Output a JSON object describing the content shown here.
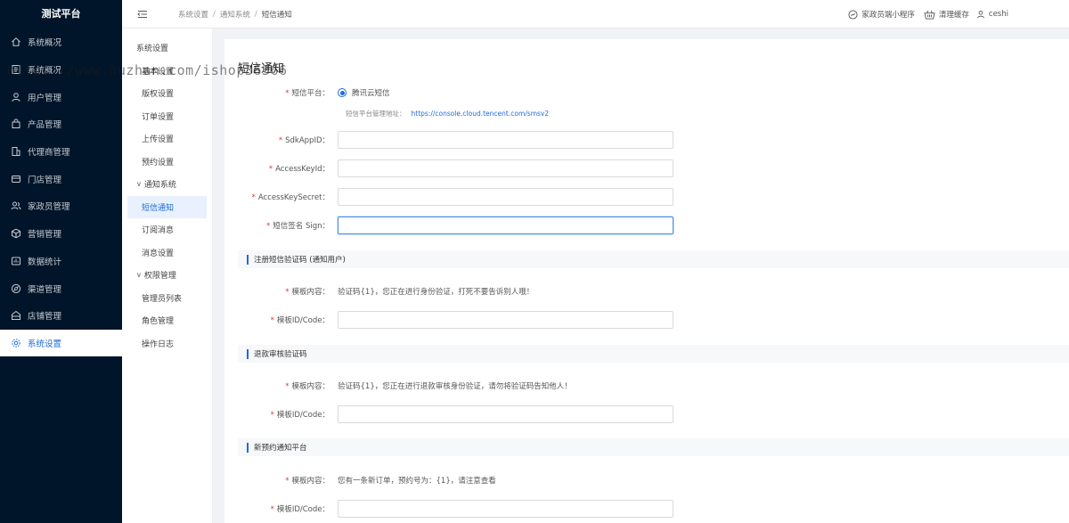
{
  "app": {
    "title": "测试平台"
  },
  "sidebar": {
    "items": [
      {
        "label": "系统概况",
        "icon": "home-icon"
      },
      {
        "label": "系统概况",
        "icon": "document-icon"
      },
      {
        "label": "用户管理",
        "icon": "user-icon"
      },
      {
        "label": "产品管理",
        "icon": "bag-icon"
      },
      {
        "label": "代理商管理",
        "icon": "building-icon"
      },
      {
        "label": "门店管理",
        "icon": "store-icon"
      },
      {
        "label": "家政员管理",
        "icon": "team-icon"
      },
      {
        "label": "营销管理",
        "icon": "cube-icon"
      },
      {
        "label": "数据统计",
        "icon": "stats-icon"
      },
      {
        "label": "渠道管理",
        "icon": "compass-icon"
      },
      {
        "label": "店铺管理",
        "icon": "shop-icon"
      },
      {
        "label": "系统设置",
        "icon": "gear-icon"
      }
    ]
  },
  "header": {
    "breadcrumb": [
      "系统设置",
      "通知系统",
      "短信通知"
    ],
    "miniprogram": "家政员端小程序",
    "clear_cache": "清理缓存",
    "user": "ceshi"
  },
  "submenu": {
    "title": "系统设置",
    "items": [
      "基本设置",
      "版权设置",
      "订单设置",
      "上传设置",
      "预约设置"
    ],
    "group_notify": "通知系统",
    "notify_items": [
      "短信通知",
      "订阅消息",
      "消息设置"
    ],
    "group_perm": "权限管理",
    "perm_items": [
      "管理员列表",
      "角色管理",
      "操作日志"
    ]
  },
  "main": {
    "title": "短信通知",
    "platform_label": "短信平台：",
    "platform_value": "腾讯云短信",
    "platform_hint": "短信平台管理地址：",
    "platform_link": "https://console.cloud.tencent.com/smsv2",
    "sdk_label": "SdkAppID：",
    "key_label": "AccessKeyId：",
    "secret_label": "AccessKeySecret：",
    "sign_label": "短信签名 Sign：",
    "sections": [
      {
        "title": "注册短信验证码 (通知用户)",
        "content_label": "模板内容：",
        "content": "验证码{1}，您正在进行身份验证，打死不要告诉别人哦！",
        "code_label": "模板ID/Code："
      },
      {
        "title": "退款审核验证码",
        "content_label": "模板内容：",
        "content": "验证码{1}，您正在进行退款审核身份验证，请勿将验证码告知他人！",
        "code_label": "模板ID/Code："
      },
      {
        "title": "新预约通知平台",
        "content_label": "模板内容：",
        "content": "您有一条新订单，预约号为：{1}，请注意查看",
        "code_label": "模板ID/Code："
      }
    ]
  },
  "watermark": "https://www.huzhan.com/ishop36366"
}
